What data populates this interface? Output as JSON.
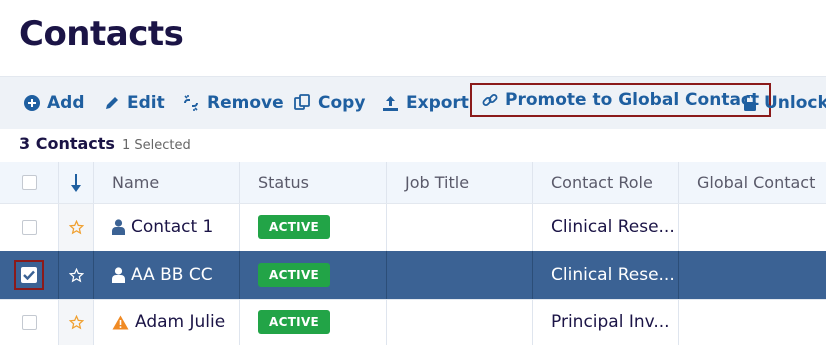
{
  "page": {
    "title": "Contacts"
  },
  "toolbar": {
    "add": "Add",
    "edit": "Edit",
    "remove": "Remove",
    "copy": "Copy",
    "export": "Export",
    "promote": "Promote to Global Contact",
    "unlock": "Unlock"
  },
  "summary": {
    "count": "3 Contacts",
    "selected": "1 Selected"
  },
  "columns": {
    "name": "Name",
    "status": "Status",
    "job_title": "Job Title",
    "contact_role": "Contact Role",
    "global_contact": "Global Contact"
  },
  "rows": [
    {
      "name": "Contact 1",
      "status": "ACTIVE",
      "job_title": "",
      "contact_role": "Clinical Rese...",
      "global_contact": "",
      "checked": false,
      "icon": "user-icon"
    },
    {
      "name": "AA BB CC",
      "status": "ACTIVE",
      "job_title": "",
      "contact_role": "Clinical Rese...",
      "global_contact": "",
      "checked": true,
      "icon": "user-icon"
    },
    {
      "name": "Adam Julie",
      "status": "ACTIVE",
      "job_title": "",
      "contact_role": "Principal Inv...",
      "global_contact": "",
      "checked": false,
      "icon": "warning-icon"
    }
  ],
  "colors": {
    "accent": "#1f5fa0",
    "title": "#1b1446",
    "selected_row": "#3b6294",
    "status_active": "#22a447",
    "highlight_border": "#8b1a1a",
    "star": "#f0a030",
    "warning": "#f08a24"
  }
}
